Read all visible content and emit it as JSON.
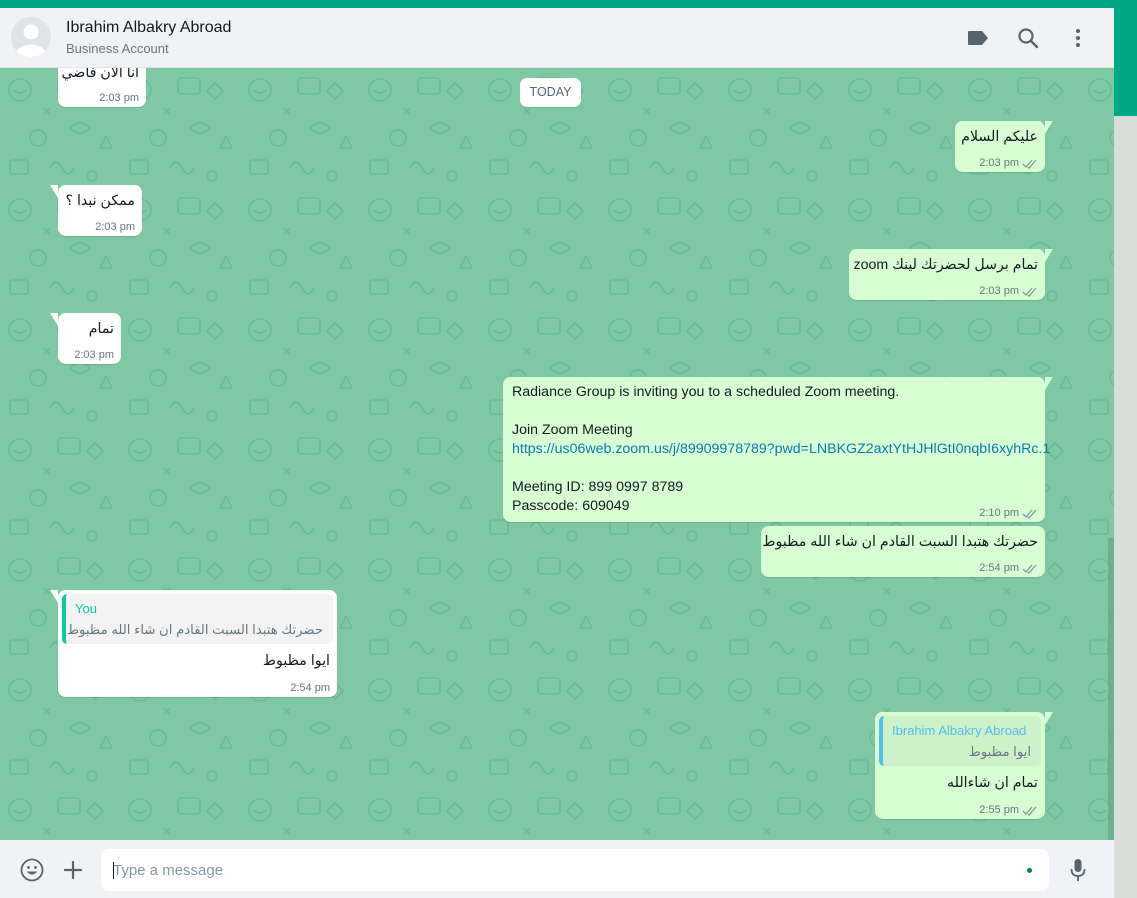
{
  "header": {
    "name": "Ibrahim Albakry Abroad",
    "subtitle": "Business Account",
    "icons": [
      "label-icon",
      "search-icon",
      "menu-icon"
    ]
  },
  "chat": {
    "date_label": "TODAY",
    "messages": [
      {
        "dir": "in",
        "text": "انا الان فاضي",
        "time": "2:03 pm"
      },
      {
        "dir": "out",
        "text": "عليكم السلام",
        "time": "2:03 pm"
      },
      {
        "dir": "in",
        "text": "ممكن نبدا ؟",
        "time": "2:03 pm"
      },
      {
        "dir": "out",
        "text": "تمام برسل لحضرتك لينك zoom",
        "time": "2:03 pm"
      },
      {
        "dir": "in",
        "text": "تمام",
        "time": "2:03 pm"
      },
      {
        "dir": "out",
        "lines": [
          "Radiance Group is inviting you to a scheduled Zoom meeting.",
          "Join Zoom Meeting",
          "https://us06web.zoom.us/j/89909978789?pwd=LNBKGZ2axtYtHJHlGtI0nqbI6xyhRc.1",
          "Meeting ID: 899 0997 8789",
          "Passcode: 609049"
        ],
        "time": "2:10 pm"
      },
      {
        "dir": "out",
        "text": "حضرتك هتبدا السبت القادم ان شاء الله مظبوط",
        "time": "2:54 pm"
      },
      {
        "dir": "in",
        "quote_name": "You",
        "quote_text": "حضرتك هتبدا السبت القادم ان شاء الله مظبوط",
        "text": "ايوا مظبوط",
        "time": "2:54 pm"
      },
      {
        "dir": "out",
        "quote_name": "Ibrahim Albakry Abroad",
        "quote_text": "ايوا مظبوط",
        "text": "تمام ان شاءالله",
        "time": "2:55 pm"
      }
    ]
  },
  "composer": {
    "placeholder": "Type a message",
    "icons": [
      "emoji-icon",
      "attach-icon",
      "microphone-icon"
    ]
  },
  "colors": {
    "accent": "#00a884",
    "chat_background": "#7fc8a4",
    "outgoing_bubble": "#d9fdd3",
    "incoming_bubble": "#ffffff",
    "link": "#027eb5",
    "quote_you": "#06cf9c",
    "quote_contact": "#53bdeb"
  }
}
